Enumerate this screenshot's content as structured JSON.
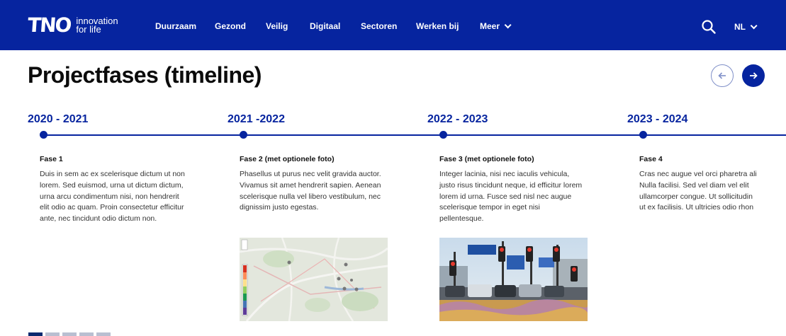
{
  "header": {
    "logo_mark": "TNO",
    "logo_line1": "innovation",
    "logo_line2": "for life",
    "nav": [
      {
        "label": "Duurzaam"
      },
      {
        "label": "Gezond"
      },
      {
        "label": "Veilig"
      },
      {
        "label": "Digitaal"
      },
      {
        "label": "Sectoren"
      },
      {
        "label": "Werken bij"
      },
      {
        "label": "Meer"
      }
    ],
    "language": "NL",
    "color": "#06249f"
  },
  "page": {
    "title": "Projectfases (timeline)"
  },
  "timeline": [
    {
      "year": "2020 - 2021",
      "title": "Fase 1",
      "text": "Duis in sem ac ex scelerisque dictum ut non lorem. Sed euismod, urna ut dictum dictum, urna arcu condimentum nisi, non hendrerit elit odio ac quam. Proin consectetur efficitur ante, nec tincidunt odio dictum non."
    },
    {
      "year": "2021 -2022",
      "title": "Fase 2 (met optionele foto)",
      "text": "Phasellus ut purus nec velit gravida auctor. Vivamus sit amet hendrerit sapien. Aenean scelerisque nulla vel libero vestibulum, nec dignissim justo egestas.",
      "image": "heatmap-city-map"
    },
    {
      "year": "2022 - 2023",
      "title": "Fase 3 (met optionele foto)",
      "text": "Integer lacinia, nisi nec iaculis vehicula, justo risus tincidunt neque, id efficitur lorem lorem id urna. Fusce sed nisl nec augue scelerisque tempor in eget nisi pellentesque.",
      "image": "traffic-lights-photo"
    },
    {
      "year": "2023 - 2024",
      "title": "Fase 4",
      "text_lines": [
        "Cras nec augue vel orci pharetra ali",
        "Nulla facilisi. Sed vel diam vel elit",
        "ullamcorper congue. Ut sollicitudin",
        "ut ex facilisis. Ut ultricies odio rhon"
      ]
    }
  ],
  "pagination": {
    "pages": 5,
    "active": 1
  },
  "icons": {
    "search": "search-icon",
    "prev": "arrow-left-icon",
    "next": "arrow-right-icon"
  }
}
